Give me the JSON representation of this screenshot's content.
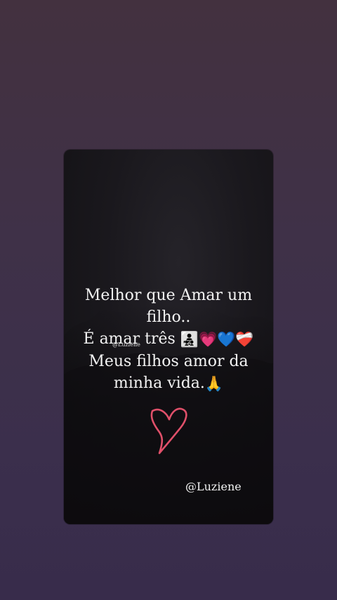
{
  "card": {
    "quote_lines": [
      "Melhor que Amar um",
      "filho..",
      "É amar três",
      "Meus filhos amor da",
      "minha vida."
    ],
    "emojis_line3": [
      "👨‍👧‍👦",
      "💗",
      "💙",
      "❤️‍🩹"
    ],
    "emoji_line5": "🙏",
    "watermark_small": "@Luziene",
    "signature": "@Luziene"
  },
  "colors": {
    "background": "#3f3148",
    "card": "#1a181d",
    "text": "#f3f3f3",
    "heart_doodle": "#e0506a"
  }
}
